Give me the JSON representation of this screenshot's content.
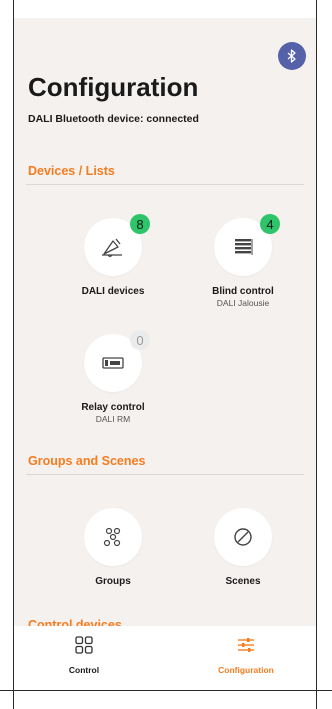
{
  "header": {
    "title": "Configuration",
    "subtitle": "DALI Bluetooth device: connected",
    "bluetooth_icon": "bluetooth-icon"
  },
  "sections": {
    "devices": "Devices / Lists",
    "groups": "Groups and Scenes",
    "control": "Control devices"
  },
  "tiles": {
    "dali_devices": {
      "label": "DALI devices",
      "count": "8",
      "icon": "lamp-icon"
    },
    "blind_control": {
      "label": "Blind control",
      "sub": "DALI Jalousie",
      "count": "4",
      "icon": "blind-icon"
    },
    "relay_control": {
      "label": "Relay control",
      "sub": "DALI RM",
      "count": "0",
      "icon": "relay-icon"
    },
    "groups": {
      "label": "Groups",
      "icon": "groups-icon"
    },
    "scenes": {
      "label": "Scenes",
      "icon": "scenes-icon"
    }
  },
  "bottom_nav": {
    "control": "Control",
    "configuration": "Configuration"
  },
  "colors": {
    "accent": "#f57c1f",
    "badge_green": "#2ec46a",
    "bluetooth": "#5561a8",
    "background": "#f5f1ef"
  }
}
